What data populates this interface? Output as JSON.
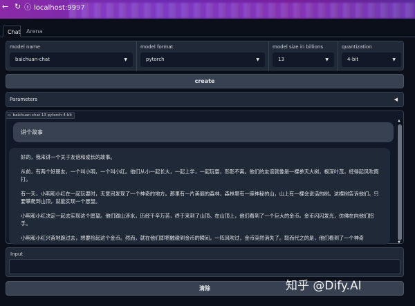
{
  "browser": {
    "url": "localhost:9997"
  },
  "tabs": [
    {
      "label": "Chat"
    },
    {
      "label": "Arena"
    }
  ],
  "config": {
    "model_name": {
      "label": "model name",
      "value": "baichuan-chat"
    },
    "model_format": {
      "label": "model format",
      "value": "pytorch"
    },
    "model_size": {
      "label": "model size in billions",
      "value": "13"
    },
    "quantization": {
      "label": "quantization",
      "value": "4-bit"
    }
  },
  "create_button": "create",
  "parameters_label": "Parameters",
  "chat": {
    "label": "baichuan-chat 13 pytorch-4-bit",
    "user_message": "讲个故事",
    "bot_paragraphs": [
      "好的，我来讲一个关于友谊和成长的故事。",
      "从前，有两个好朋友，一个叫小明，一个叫小红。他们从小一起长大，一起上学，一起玩耍，形影不离。他们的友谊就像是一棵参天大树，根深叶茂，经得起风吹雨打。",
      "有一天，小明和小红在一起玩耍时，无意间发现了一个神奇的地方。那里有一片美丽的森林，森林里有一座神秘的山，山上有一棵会说话的树。这棵树告诉他们，只要攀爬到山顶，就能实现一个愿望。",
      "小明和小红决定一起去实现这个愿望。他们跋山涉水，历经千辛万苦，终于来到了山顶。在山顶上，他们看到了一个巨大的金币。金币闪闪发光，仿佛在向他们招手。",
      "小明和小红兴奋地跑过去，想要捡起这个金币。然而，就在他们即将触碰到金币的瞬间，一阵风吹过，金币突然消失了。取而代之的是，他们看到了一个神奇"
    ]
  },
  "input": {
    "label": "Input",
    "value": ""
  },
  "clear_button": "清除",
  "watermark": "知乎 @Dify.AI"
}
